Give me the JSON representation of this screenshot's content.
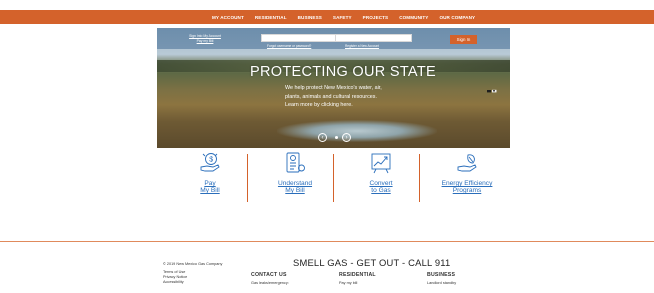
{
  "colors": {
    "brand_orange": "#d4622b",
    "link_blue": "#2a6ebb"
  },
  "nav": {
    "items": [
      {
        "label": "MY ACCOUNT"
      },
      {
        "label": "RESIDENTIAL"
      },
      {
        "label": "BUSINESS"
      },
      {
        "label": "SAFETY"
      },
      {
        "label": "PROJECTS"
      },
      {
        "label": "COMMUNITY"
      },
      {
        "label": "OUR COMPANY"
      }
    ]
  },
  "login": {
    "sign_into_account": "Sign Into My Account",
    "pay_my_bill": "Pay my Bill",
    "forgot": "Forgot username or password?",
    "register": "Register a New Account",
    "sign_in": "Sign In"
  },
  "hero": {
    "title": "PROTECTING OUR STATE",
    "text": "We help protect New Mexico's water, air, plants, animals and cultural resources. Learn more by clicking here.",
    "prev_icon": "arrow-left-icon",
    "next_icon": "arrow-right-icon"
  },
  "quick_links": [
    {
      "line1": "Pay",
      "line2": "My Bill",
      "icon": "hand-money-icon"
    },
    {
      "line1": "Understand",
      "line2": "My Bill",
      "icon": "bill-document-icon"
    },
    {
      "line1": "Convert",
      "line2": "to Gas",
      "icon": "chart-growth-icon"
    },
    {
      "line1": "Energy Efficiency",
      "line2": "Programs",
      "icon": "hand-leaf-icon"
    }
  ],
  "footer": {
    "copyright": "© 2019 New Mexico Gas Company",
    "links": [
      "Terms of Use",
      "Privacy Notice",
      "Accessibility"
    ],
    "headline": "SMELL GAS - GET OUT - CALL 911",
    "contact": {
      "heading": "CONTACT US",
      "item1": "Gas leaks/emergency:"
    },
    "residential": {
      "heading": "RESIDENTIAL",
      "item1": "Pay my bill"
    },
    "business": {
      "heading": "BUSINESS",
      "item1": "Landlord standby"
    }
  }
}
